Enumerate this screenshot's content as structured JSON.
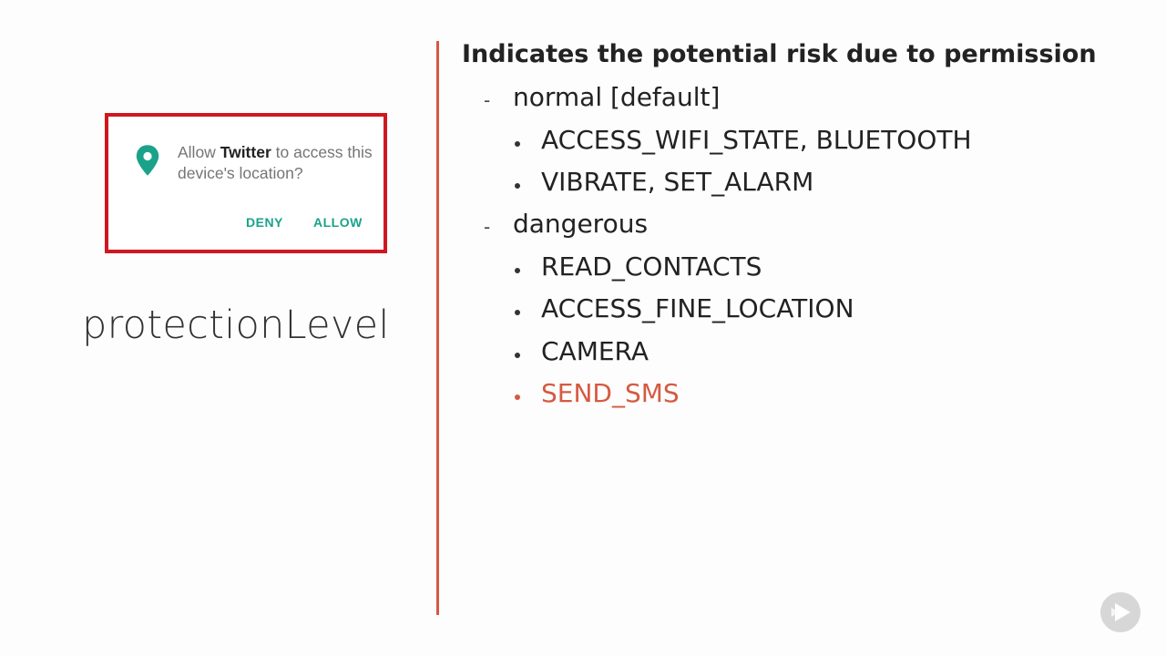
{
  "dialog": {
    "text_pre": "Allow ",
    "app_name": "Twitter",
    "text_post": " to access this device's location?",
    "deny_label": "DENY",
    "allow_label": "ALLOW",
    "accent_color": "#1aa38a",
    "border_color": "#d0171f",
    "icon": "location-pin-icon"
  },
  "slide_title": "protectionLevel",
  "heading": "Indicates the potential risk due to permission",
  "levels": [
    {
      "dash": "-",
      "label": "normal [default]",
      "items": [
        "ACCESS_WIFI_STATE, BLUETOOTH",
        "VIBRATE, SET_ALARM"
      ]
    },
    {
      "dash": "-",
      "label": "dangerous",
      "items": [
        "READ_CONTACTS",
        "ACCESS_FINE_LOCATION",
        "CAMERA",
        "SEND_SMS"
      ]
    }
  ],
  "highlight_color": "#d55a42",
  "divider_color": "#d35a43",
  "badge_icon": "play-logo-icon"
}
